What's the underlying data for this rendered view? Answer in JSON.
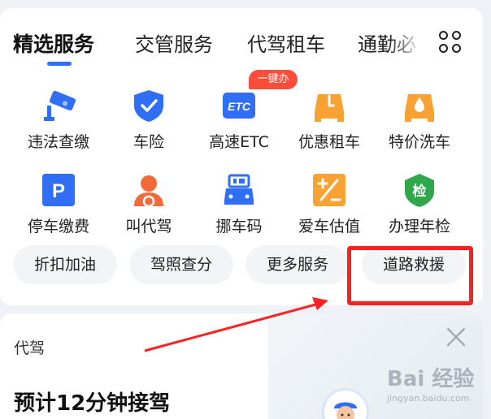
{
  "tabs": [
    {
      "label": "精选服务",
      "active": true
    },
    {
      "label": "交管服务"
    },
    {
      "label": "代驾租车"
    },
    {
      "label": "通勤必"
    }
  ],
  "services_row1": [
    {
      "label": "违法查缴",
      "icon": "camera-icon"
    },
    {
      "label": "车险",
      "icon": "shield-check-icon"
    },
    {
      "label": "高速ETC",
      "icon": "etc-icon"
    },
    {
      "label": "优惠租车",
      "icon": "car-key-icon"
    },
    {
      "label": "特价洗车",
      "icon": "car-wash-icon"
    }
  ],
  "services_row2": [
    {
      "label": "停车缴费",
      "icon": "parking-icon"
    },
    {
      "label": "叫代驾",
      "icon": "driver-icon"
    },
    {
      "label": "挪车码",
      "icon": "move-car-icon"
    },
    {
      "label": "爱车估值",
      "icon": "valuation-icon"
    },
    {
      "label": "办理年检",
      "icon": "inspection-icon"
    }
  ],
  "etc_badge": "一键办",
  "etc_icon_text": "ETC",
  "parking_icon_text": "P",
  "inspection_icon_text": "检",
  "pills": [
    "折扣加油",
    "驾照查分",
    "更多服务",
    "道路救援"
  ],
  "designated_driver": {
    "title": "代驾",
    "eta": "预计12分钟接驾"
  },
  "watermark": {
    "main": "Bai 经验",
    "sub": "jingyan.baidu.com"
  },
  "colors": {
    "accent": "#2f6ef5",
    "orange": "#f7a233",
    "red": "#ff1f1f",
    "green": "#2ea84a"
  }
}
